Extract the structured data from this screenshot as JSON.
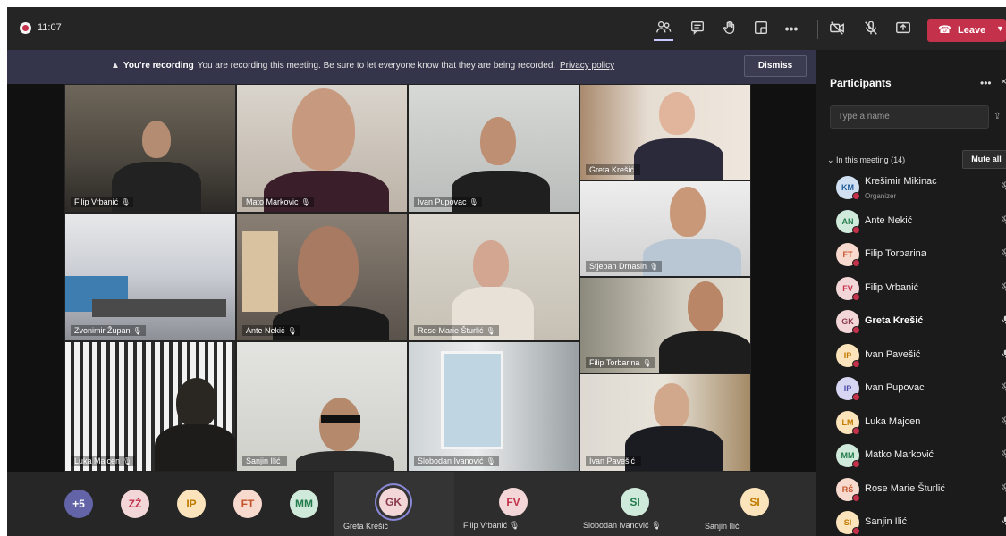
{
  "topbar": {
    "clock": "11:07",
    "icons": [
      "people-icon",
      "chat-icon",
      "raise-hand-icon",
      "rooms-icon",
      "more-icon",
      "camera-off-icon",
      "mic-off-icon",
      "share-icon"
    ],
    "more_label": "•••",
    "leave_label": "Leave"
  },
  "banner": {
    "bold": "You're recording",
    "text": "You are recording this meeting. Be sure to let everyone know that they are being recorded.",
    "link": "Privacy policy",
    "dismiss": "Dismiss"
  },
  "tiles": [
    {
      "name": "Filip Vrbanić",
      "mic": "🎙"
    },
    {
      "name": "Mato Markovic",
      "mic": "🎙"
    },
    {
      "name": "Ivan Pupovac",
      "mic": "🎙"
    },
    {
      "name": "Greta Krešić",
      "mic": ""
    },
    {
      "name": "Stjepan Drnasin",
      "mic": "🎙"
    },
    {
      "name": "Zvonimir Župan",
      "mic": "🎙"
    },
    {
      "name": "Ante Nekić",
      "mic": "🎙"
    },
    {
      "name": "Rose Marie Šturlić",
      "mic": "🎙"
    },
    {
      "name": "Filip Torbarina",
      "mic": "🎙"
    },
    {
      "name": "Luka Majcen",
      "mic": "🎙"
    },
    {
      "name": "Sanjin Ilić",
      "mic": ""
    },
    {
      "name": "Slobodan Ivanović",
      "mic": "🎙"
    },
    {
      "name": "Ivan Pavešić",
      "mic": ""
    }
  ],
  "bottom": {
    "avatars": [
      {
        "initials": "+5",
        "bg": "#6264a7",
        "fg": "#ffffff"
      },
      {
        "initials": "ZŽ",
        "bg": "#f3d6d8",
        "fg": "#c4314b"
      },
      {
        "initials": "IP",
        "bg": "#fbe3bb",
        "fg": "#c07b00"
      },
      {
        "initials": "FT",
        "bg": "#f7d9cd",
        "fg": "#c4542b"
      },
      {
        "initials": "MM",
        "bg": "#cfe9da",
        "fg": "#237b4b"
      }
    ],
    "tiles": [
      {
        "initials": "GK",
        "name": "Greta Krešić",
        "mic": "",
        "bg": "#f3d6d8",
        "fg": "#8a3a4a"
      },
      {
        "initials": "FV",
        "name": "Filip Vrbanić",
        "mic": "🎙",
        "bg": "#f3d6d8",
        "fg": "#c4314b"
      },
      {
        "initials": "SI",
        "name": "Slobodan Ivanović",
        "mic": "🎙",
        "bg": "#cfe9da",
        "fg": "#237b4b"
      },
      {
        "initials": "SI",
        "name": "Sanjin Ilić",
        "mic": "",
        "bg": "#fbe3bb",
        "fg": "#c07b00"
      }
    ]
  },
  "panel": {
    "title": "Participants",
    "more": "•••",
    "close": "×",
    "search_placeholder": "Type a name",
    "section": "In this meeting (14)",
    "mute_all": "Mute all",
    "participants": [
      {
        "initials": "KM",
        "name": "Krešimir Mikinac",
        "role": "Organizer",
        "bg": "#d0e0f2",
        "fg": "#1f5b99",
        "mic": "muted"
      },
      {
        "initials": "AN",
        "name": "Ante Nekić",
        "role": "",
        "bg": "#cfe9da",
        "fg": "#237b4b",
        "mic": "muted"
      },
      {
        "initials": "FT",
        "name": "Filip Torbarina",
        "role": "",
        "bg": "#f7d9cd",
        "fg": "#c4542b",
        "mic": "muted"
      },
      {
        "initials": "FV",
        "name": "Filip Vrbanić",
        "role": "",
        "bg": "#f3d6d8",
        "fg": "#c4314b",
        "mic": "muted"
      },
      {
        "initials": "GK",
        "name": "Greta Krešić",
        "role": "",
        "bg": "#f3d6d8",
        "fg": "#8a3a4a",
        "mic": "on"
      },
      {
        "initials": "IP",
        "name": "Ivan Pavešić",
        "role": "",
        "bg": "#fbe3bb",
        "fg": "#c07b00",
        "mic": "on"
      },
      {
        "initials": "IP",
        "name": "Ivan Pupovac",
        "role": "",
        "bg": "#d6d6f2",
        "fg": "#4b4ba7",
        "mic": "muted"
      },
      {
        "initials": "LM",
        "name": "Luka Majcen",
        "role": "",
        "bg": "#fbe3bb",
        "fg": "#c07b00",
        "mic": "muted"
      },
      {
        "initials": "MM",
        "name": "Matko Marković",
        "role": "",
        "bg": "#cfe9da",
        "fg": "#237b4b",
        "mic": "muted"
      },
      {
        "initials": "RŠ",
        "name": "Rose Marie Šturlić",
        "role": "",
        "bg": "#f7d9cd",
        "fg": "#c4542b",
        "mic": "muted"
      },
      {
        "initials": "SI",
        "name": "Sanjin Ilić",
        "role": "",
        "bg": "#fbe3bb",
        "fg": "#c07b00",
        "mic": "on"
      }
    ]
  }
}
